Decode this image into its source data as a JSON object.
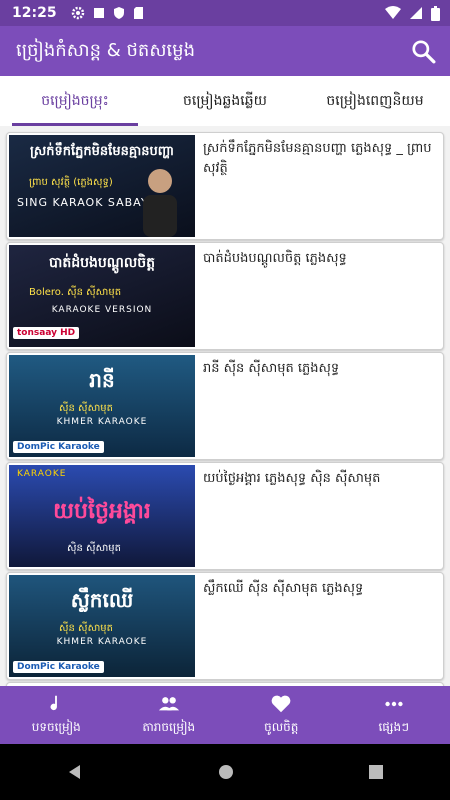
{
  "status": {
    "time": "12:25"
  },
  "app": {
    "title": "ច្រៀងកំសាន្ត & ថតសម្លេង"
  },
  "tabs": [
    {
      "label": "ចម្រៀងចម្រុះ",
      "active": true
    },
    {
      "label": "ចម្រៀងឆ្លងឆ្លើយ",
      "active": false
    },
    {
      "label": "ចម្រៀងពេញនិយម",
      "active": false
    }
  ],
  "songs": [
    {
      "title": "ស្រក់ទឹកភ្នែកមិនមែនគ្មានបញ្ហា ភ្លេងសុទ្ធ _ ព្រាប សុវត្ថិ",
      "thumb_title": "ស្រក់ទឹកភ្នែកមិនមែនគ្មានបញ្ហា",
      "thumb_sub": "ព្រាប សុវត្ថិ (ភ្លេងសុទ្ធ)",
      "thumb_caption": "SING KARAOK SABAY",
      "brand": "",
      "bg": "#1a2a44"
    },
    {
      "title": "បាត់ដំបងបណ្ដូលចិត្ត ភ្លេងសុទ្ធ",
      "thumb_title": "បាត់ដំបងបណ្ដូលចិត្ត",
      "thumb_sub": "Bolero. ស៊ីន ស៊ីសាមុត",
      "thumb_caption": "KARAOKE VERSION",
      "brand": "tonsaay HD",
      "bg": "#121a30"
    },
    {
      "title": "រានី ស៊ីន ស៊ីសាមុត ភ្លេងសុទ្ធ",
      "thumb_title": "រានី",
      "thumb_sub": "ស៊ីន ស៊ីសាមុត",
      "thumb_caption": "KHMER KARAOKE",
      "brand": "DomPic Karaoke",
      "bg": "#1b4f75"
    },
    {
      "title": "យប់ថ្ងៃអង្គារ ភ្លេងសុទ្ធ ស៊ិន ស៊ីសាមុត",
      "thumb_title": "យប់ថ្ងៃអង្គារ",
      "thumb_sub": "ស៊ិន ស៊ីសាមុត",
      "thumb_caption": "KARAOKE",
      "brand": "",
      "bg": "#263a8a"
    },
    {
      "title": "ស្លឹកឈើ ស៊ីន ស៊ីសាមុត ភ្លេងសុទ្ធ",
      "thumb_title": "ស្លឹកឈើ",
      "thumb_sub": "ស៊ីន ស៊ីសាមុត",
      "thumb_caption": "KHMER KARAOKE",
      "brand": "DomPic Karaoke",
      "bg": "#1d4a6e"
    }
  ],
  "bottom_nav": [
    {
      "label": "បទចម្រៀង",
      "icon": "music-note-icon"
    },
    {
      "label": "តារាចម្រៀង",
      "icon": "people-icon"
    },
    {
      "label": "ចូលចិត្ត",
      "icon": "heart-icon"
    },
    {
      "label": "ផ្សេងៗ",
      "icon": "more-icon"
    }
  ]
}
